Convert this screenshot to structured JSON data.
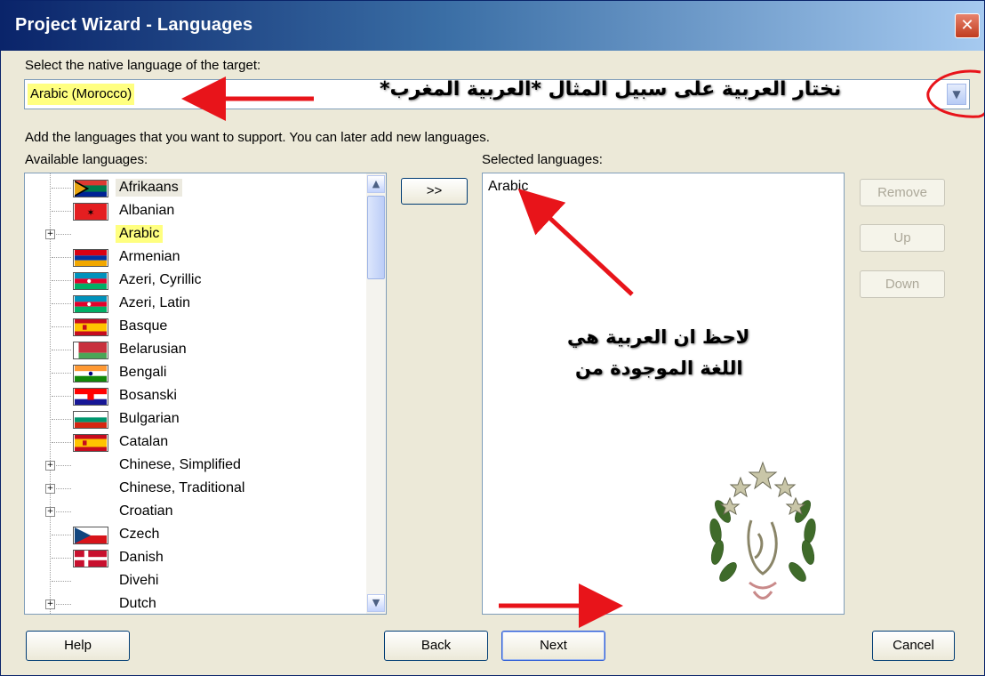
{
  "window": {
    "title": "Project Wizard - Languages",
    "close_symbol": "✕"
  },
  "native": {
    "label": "Select the native language of the target:",
    "value": "Arabic (Morocco)",
    "note": "نختار العربية على سبيل المثال *العربية المغرب*"
  },
  "instructions": "Add the languages that you want to support. You can later add new languages.",
  "available": {
    "label": "Available languages:",
    "items": [
      {
        "label": "Afrikaans",
        "flag": "za"
      },
      {
        "label": "Albanian",
        "flag": "al"
      },
      {
        "label": "Arabic",
        "flag": "",
        "expandable": true
      },
      {
        "label": "Armenian",
        "flag": "am"
      },
      {
        "label": "Azeri, Cyrillic",
        "flag": "az"
      },
      {
        "label": "Azeri, Latin",
        "flag": "az"
      },
      {
        "label": "Basque",
        "flag": "es"
      },
      {
        "label": "Belarusian",
        "flag": "by"
      },
      {
        "label": "Bengali",
        "flag": "in"
      },
      {
        "label": "Bosanski",
        "flag": "hr"
      },
      {
        "label": "Bulgarian",
        "flag": "bg"
      },
      {
        "label": "Catalan",
        "flag": "es"
      },
      {
        "label": "Chinese, Simplified",
        "flag": "",
        "expandable": true
      },
      {
        "label": "Chinese, Traditional",
        "flag": "",
        "expandable": true
      },
      {
        "label": "Croatian",
        "flag": "",
        "expandable": true
      },
      {
        "label": "Czech",
        "flag": "cz"
      },
      {
        "label": "Danish",
        "flag": "dk"
      },
      {
        "label": "Divehi",
        "flag": ""
      },
      {
        "label": "Dutch",
        "flag": "",
        "expandable": true
      }
    ]
  },
  "add_button": ">>",
  "selected": {
    "label": "Selected languages:",
    "items": [
      "Arabic"
    ],
    "note_line1": "لاحظ ان العربية هي",
    "note_line2": "اللغة الموجودة من"
  },
  "side_buttons": {
    "remove": "Remove",
    "up": "Up",
    "down": "Down"
  },
  "footer_buttons": {
    "help": "Help",
    "back": "Back",
    "next": "Next",
    "cancel": "Cancel"
  },
  "colors": {
    "highlight": "#ffff80",
    "arrow": "#e8141a",
    "title_bar": "#0a246a"
  }
}
